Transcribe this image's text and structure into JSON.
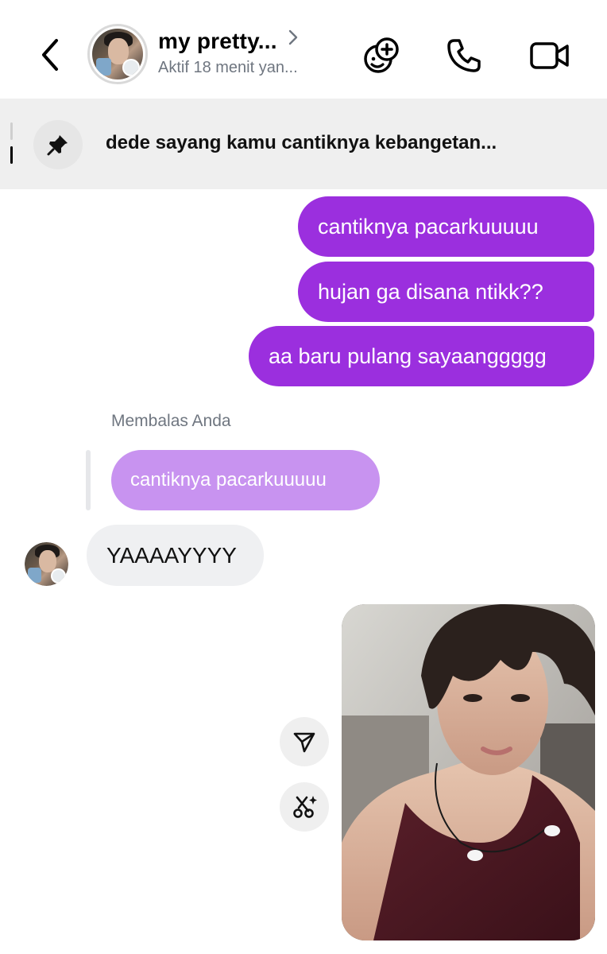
{
  "header": {
    "back_icon": "chevron-left-icon",
    "chat_name": "my pretty...",
    "chat_status": "Aktif 18 menit yan...",
    "icons": [
      "sticker-add-icon",
      "phone-icon",
      "video-camera-icon"
    ]
  },
  "pinned": {
    "icon": "pin-icon",
    "text": "dede sayang kamu cantiknya kebangetan..."
  },
  "messages": {
    "outgoing": [
      "cantiknya pacarkuuuuu",
      "hujan ga disana ntikk??",
      "aa baru pulang sayaanggggg"
    ],
    "reply_label": "Membalas Anda",
    "reply_quote": "cantiknya pacarkuuuuu",
    "incoming": "YAAAAYYYY"
  },
  "photo_actions": [
    "share-icon",
    "remix-icon"
  ],
  "colors": {
    "outgoing_bubble": "#9b2fde",
    "quoted_bubble": "#c893f0",
    "incoming_bubble": "#eff0f2",
    "pinned_bar": "#efefef",
    "secondary_text": "#6f7680"
  }
}
